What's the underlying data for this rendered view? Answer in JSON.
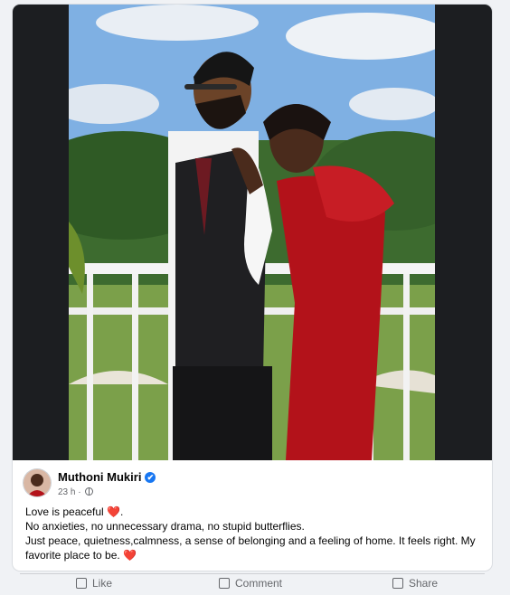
{
  "post": {
    "author": "Muthoni Mukiri",
    "verified": true,
    "timestamp": "23 h",
    "separator": "·",
    "audience_icon": "globe-icon",
    "text_line1": "Love is peaceful",
    "text_line2": "No anxieties, no unnecessary drama, no stupid butterflies.",
    "text_line3": "Just peace, quietness,calmness, a sense of belonging and a feeling of home. It feels right. My favorite place to be.",
    "heart_emoji": "❤️",
    "verified_glyph": "✔"
  },
  "actions": {
    "like_label": "Like",
    "comment_label": "Comment",
    "share_label": "Share"
  },
  "colors": {
    "card_bg": "#ffffff",
    "page_bg": "#f0f2f5",
    "verified": "#1877f2",
    "heart": "#e41e3f",
    "secondary_text": "#65676b"
  }
}
